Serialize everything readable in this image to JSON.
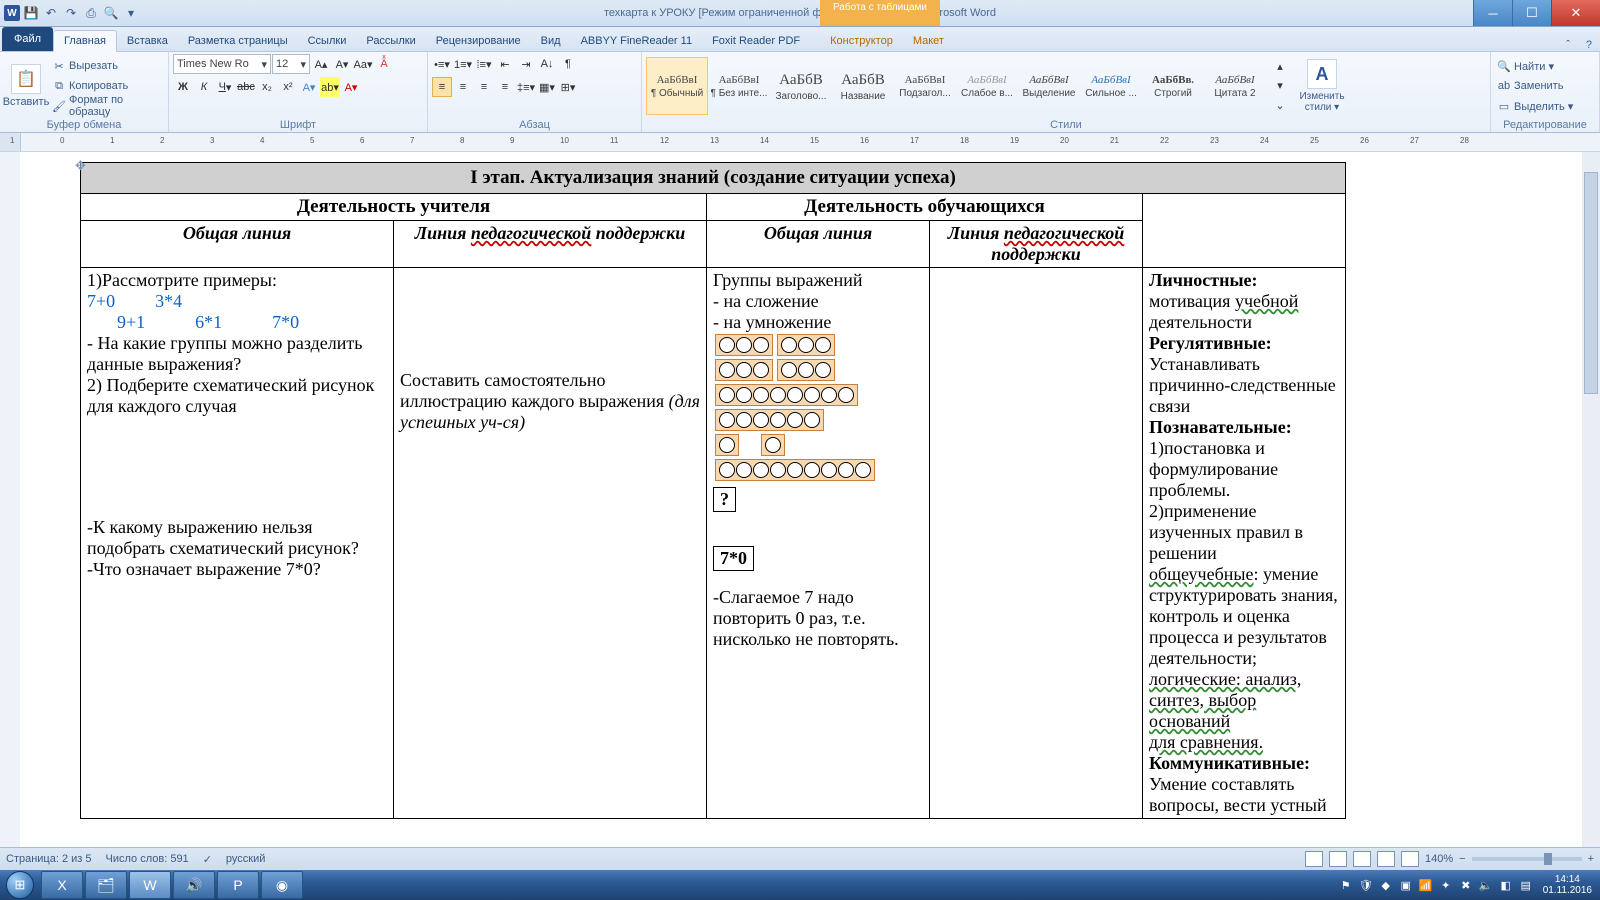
{
  "titlebar": {
    "title": "техкарта к УРОКУ [Режим ограниченной функциональности] - Microsoft Word",
    "table_tools": "Работа с таблицами"
  },
  "tabs": {
    "file": "Файл",
    "items": [
      "Главная",
      "Вставка",
      "Разметка страницы",
      "Ссылки",
      "Рассылки",
      "Рецензирование",
      "Вид",
      "ABBYY FineReader 11",
      "Foxit Reader PDF"
    ],
    "ctx": [
      "Конструктор",
      "Макет"
    ]
  },
  "clipboard": {
    "paste": "Вставить",
    "cut": "Вырезать",
    "copy": "Копировать",
    "fmt": "Формат по образцу",
    "cap": "Буфер обмена"
  },
  "font": {
    "name": "Times New Ro",
    "size": "12",
    "cap": "Шрифт"
  },
  "para": {
    "cap": "Абзац"
  },
  "styles": {
    "cap": "Стили",
    "change": "Изменить стили ▾",
    "items": [
      {
        "prev": "АаБбВвІ",
        "lbl": "¶ Обычный",
        "sel": true
      },
      {
        "prev": "АаБбВвІ",
        "lbl": "¶ Без инте..."
      },
      {
        "prev": "АаБбВ",
        "lbl": "Заголово...",
        "big": true
      },
      {
        "prev": "АаБбВ",
        "lbl": "Название",
        "big": true
      },
      {
        "prev": "АаБбВвІ",
        "lbl": "Подзагол..."
      },
      {
        "prev": "АаБбВвІ",
        "lbl": "Слабое в...",
        "it": true,
        "gray": true
      },
      {
        "prev": "АаБбВвІ",
        "lbl": "Выделение",
        "it": true
      },
      {
        "prev": "АаБбВвІ",
        "lbl": "Сильное ...",
        "it": true,
        "blue": true
      },
      {
        "prev": "АаБбВв.",
        "lbl": "Строгий",
        "bold": true
      },
      {
        "prev": "АаБбВвІ",
        "lbl": "Цитата 2",
        "it": true
      }
    ]
  },
  "editing": {
    "find": "Найти ▾",
    "replace": "Заменить",
    "select": "Выделить ▾",
    "cap": "Редактирование"
  },
  "doc": {
    "stage": "I этап. Актуализация знаний (создание ситуации успеха)",
    "h1": "Деятельность учителя",
    "h2": "Деятельность обучающихся",
    "sub_common": "Общая линия",
    "sub_ped1": "Линия",
    "sub_ped2": "педагогической",
    "sub_ped3": "поддержки",
    "c1_l1": "1)Рассмотрите примеры:",
    "c1_e1": "7+0",
    "c1_e2": "3*4",
    "c1_e3": "9+1",
    "c1_e4": "6*1",
    "c1_e5": "7*0",
    "c1_l2": "- На какие группы можно разделить данные выражения?",
    "c1_l3": "2)  Подберите схематический рисунок для каждого случая",
    "c1_l4": "-К какому выражению нельзя подобрать схематический рисунок?",
    "c1_l5": "-Что означает выражение 7*0?",
    "c2_l1": "Составить самостоятельно иллюстрацию каждого выражения",
    "c2_l2": "(для успешных уч-ся)",
    "c3_l1": "Группы выражений",
    "c3_l2": "- на сложение",
    "c3_l3": "- на умножение",
    "c3_q": "?",
    "c3_b": "7*0",
    "c3_l4": "-Слагаемое 7 надо повторить 0 раз, т.е. нисколько не повторять.",
    "c5_p1a": "Личностные:",
    "c5_p1b": "мотивация",
    "c5_p1c": "учебной",
    "c5_p1d": "деятельности",
    "c5_p2a": "Регулятивные:",
    "c5_p2b": "Устанавливать причинно-следственные связи",
    "c5_p3a": "Познавательные:",
    "c5_p3b": "1)постановка и формулирование проблемы.",
    "c5_p3c": "2)применение изученных правил в решении",
    "c5_p3d": "общеучебные",
    "c5_p3e": ": умение структурировать знания, контроль и оценка процесса и результатов деятельности;",
    "c5_p3f": "логические: анализ,",
    "c5_p3g": "синтез, выбор оснований",
    "c5_p3h": "для сравнения.",
    "c5_p4a": "Коммуникативные:",
    "c5_p4b": "Умение составлять вопросы, вести устный"
  },
  "status": {
    "page": "Страница: 2 из 5",
    "words": "Число слов: 591",
    "lang": "русский",
    "zoom": "140%"
  },
  "tray": {
    "time": "14:14",
    "date": "01.11.2016"
  }
}
